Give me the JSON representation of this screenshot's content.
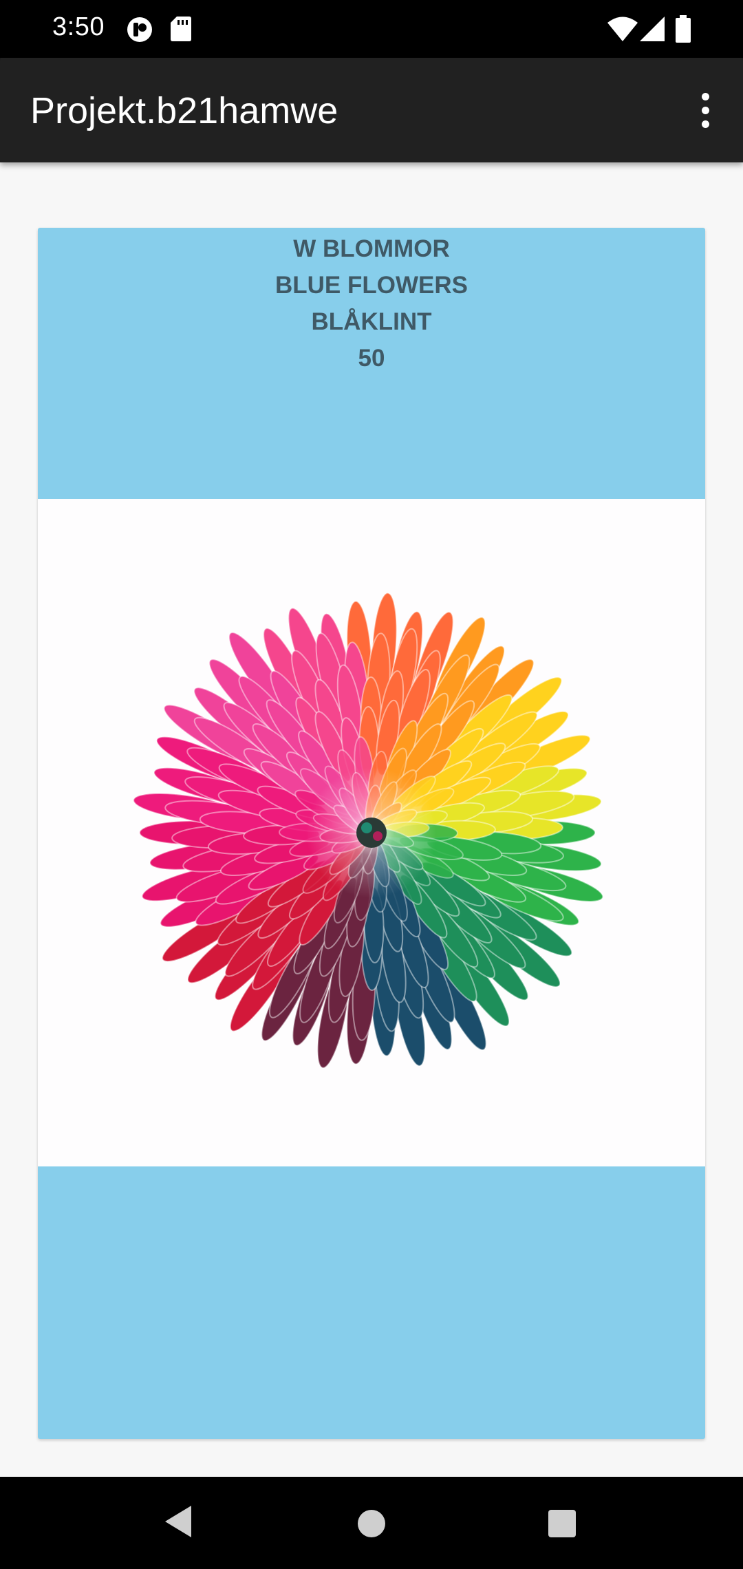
{
  "status_bar": {
    "time": "3:50",
    "icons": [
      "notification-app-icon",
      "sd-card-icon",
      "wifi-icon",
      "signal-icon",
      "battery-icon"
    ]
  },
  "app_bar": {
    "title": "Projekt.b21hamwe",
    "overflow_icon": "more-vert-icon"
  },
  "card": {
    "lines": [
      "W BLOMMOR",
      "BLUE FLOWERS",
      "BLÅKLINT",
      "50"
    ],
    "background_color": "#87ceeb",
    "text_color": "#3f5966",
    "image": "rainbow-chrysanthemum-flower"
  },
  "nav_bar": {
    "icons": [
      "back-icon",
      "home-icon",
      "recents-icon"
    ]
  }
}
